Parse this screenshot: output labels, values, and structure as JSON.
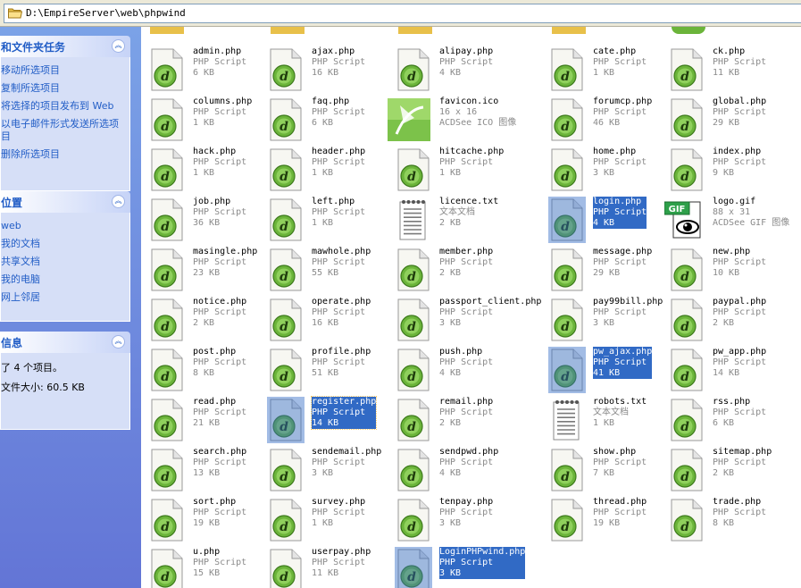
{
  "address_bar": {
    "path": "D:\\EmpireServer\\web\\phpwind"
  },
  "task_pane": {
    "file_tasks": {
      "title": "和文件夹任务",
      "items": [
        "移动所选项目",
        "复制所选项目",
        "将选择的项目发布到 Web",
        "以电子邮件形式发送所选项目",
        "删除所选项目"
      ]
    },
    "other_places": {
      "title": "位置",
      "items": [
        "web",
        "我的文档",
        "共享文档",
        "我的电脑",
        "网上邻居"
      ]
    },
    "details": {
      "title": "信息",
      "selected": "了 4 个项目。",
      "total_size": "文件大小: 60.5 KB"
    }
  },
  "files": [
    {
      "name": "admin.php",
      "type": "PHP Script",
      "size": "6 KB",
      "icon": "php",
      "selected": false
    },
    {
      "name": "ajax.php",
      "type": "PHP Script",
      "size": "16 KB",
      "icon": "php",
      "selected": false
    },
    {
      "name": "alipay.php",
      "type": "PHP Script",
      "size": "4 KB",
      "icon": "php",
      "selected": false
    },
    {
      "name": "cate.php",
      "type": "PHP Script",
      "size": "1 KB",
      "icon": "php",
      "selected": false
    },
    {
      "name": "ck.php",
      "type": "PHP Script",
      "size": "11 KB",
      "icon": "php",
      "selected": false
    },
    {
      "name": "columns.php",
      "type": "PHP Script",
      "size": "1 KB",
      "icon": "php",
      "selected": false
    },
    {
      "name": "faq.php",
      "type": "PHP Script",
      "size": "6 KB",
      "icon": "php",
      "selected": false
    },
    {
      "name": "favicon.ico",
      "type": "16 x 16",
      "size": "ACDSee ICO 图像",
      "icon": "ico",
      "selected": false
    },
    {
      "name": "forumcp.php",
      "type": "PHP Script",
      "size": "46 KB",
      "icon": "php",
      "selected": false
    },
    {
      "name": "global.php",
      "type": "PHP Script",
      "size": "29 KB",
      "icon": "php",
      "selected": false
    },
    {
      "name": "hack.php",
      "type": "PHP Script",
      "size": "1 KB",
      "icon": "php",
      "selected": false
    },
    {
      "name": "header.php",
      "type": "PHP Script",
      "size": "1 KB",
      "icon": "php",
      "selected": false
    },
    {
      "name": "hitcache.php",
      "type": "PHP Script",
      "size": "1 KB",
      "icon": "php",
      "selected": false
    },
    {
      "name": "home.php",
      "type": "PHP Script",
      "size": "3 KB",
      "icon": "php",
      "selected": false
    },
    {
      "name": "index.php",
      "type": "PHP Script",
      "size": "9 KB",
      "icon": "php",
      "selected": false
    },
    {
      "name": "job.php",
      "type": "PHP Script",
      "size": "36 KB",
      "icon": "php",
      "selected": false
    },
    {
      "name": "left.php",
      "type": "PHP Script",
      "size": "1 KB",
      "icon": "php",
      "selected": false
    },
    {
      "name": "licence.txt",
      "type": "文本文档",
      "size": "2 KB",
      "icon": "txt",
      "selected": false
    },
    {
      "name": "login.php",
      "type": "PHP Script",
      "size": "4 KB",
      "icon": "php",
      "selected": true
    },
    {
      "name": "logo.gif",
      "type": "88 x 31",
      "size": "ACDSee GIF 图像",
      "icon": "gif",
      "selected": false
    },
    {
      "name": "masingle.php",
      "type": "PHP Script",
      "size": "23 KB",
      "icon": "php",
      "selected": false
    },
    {
      "name": "mawhole.php",
      "type": "PHP Script",
      "size": "55 KB",
      "icon": "php",
      "selected": false
    },
    {
      "name": "member.php",
      "type": "PHP Script",
      "size": "2 KB",
      "icon": "php",
      "selected": false
    },
    {
      "name": "message.php",
      "type": "PHP Script",
      "size": "29 KB",
      "icon": "php",
      "selected": false
    },
    {
      "name": "new.php",
      "type": "PHP Script",
      "size": "10 KB",
      "icon": "php",
      "selected": false
    },
    {
      "name": "notice.php",
      "type": "PHP Script",
      "size": "2 KB",
      "icon": "php",
      "selected": false
    },
    {
      "name": "operate.php",
      "type": "PHP Script",
      "size": "16 KB",
      "icon": "php",
      "selected": false
    },
    {
      "name": "passport_client.php",
      "type": "PHP Script",
      "size": "3 KB",
      "icon": "php",
      "selected": false
    },
    {
      "name": "pay99bill.php",
      "type": "PHP Script",
      "size": "3 KB",
      "icon": "php",
      "selected": false
    },
    {
      "name": "paypal.php",
      "type": "PHP Script",
      "size": "2 KB",
      "icon": "php",
      "selected": false
    },
    {
      "name": "post.php",
      "type": "PHP Script",
      "size": "8 KB",
      "icon": "php",
      "selected": false
    },
    {
      "name": "profile.php",
      "type": "PHP Script",
      "size": "51 KB",
      "icon": "php",
      "selected": false
    },
    {
      "name": "push.php",
      "type": "PHP Script",
      "size": "4 KB",
      "icon": "php",
      "selected": false
    },
    {
      "name": "pw_ajax.php",
      "type": "PHP Script",
      "size": "41 KB",
      "icon": "php",
      "selected": true
    },
    {
      "name": "pw_app.php",
      "type": "PHP Script",
      "size": "14 KB",
      "icon": "php",
      "selected": false
    },
    {
      "name": "read.php",
      "type": "PHP Script",
      "size": "21 KB",
      "icon": "php",
      "selected": false
    },
    {
      "name": "register.php",
      "type": "PHP Script",
      "size": "14 KB",
      "icon": "php",
      "selected": true,
      "focused": true
    },
    {
      "name": "remail.php",
      "type": "PHP Script",
      "size": "2 KB",
      "icon": "php",
      "selected": false
    },
    {
      "name": "robots.txt",
      "type": "文本文档",
      "size": "1 KB",
      "icon": "txt",
      "selected": false
    },
    {
      "name": "rss.php",
      "type": "PHP Script",
      "size": "6 KB",
      "icon": "php",
      "selected": false
    },
    {
      "name": "search.php",
      "type": "PHP Script",
      "size": "13 KB",
      "icon": "php",
      "selected": false
    },
    {
      "name": "sendemail.php",
      "type": "PHP Script",
      "size": "3 KB",
      "icon": "php",
      "selected": false
    },
    {
      "name": "sendpwd.php",
      "type": "PHP Script",
      "size": "4 KB",
      "icon": "php",
      "selected": false
    },
    {
      "name": "show.php",
      "type": "PHP Script",
      "size": "7 KB",
      "icon": "php",
      "selected": false
    },
    {
      "name": "sitemap.php",
      "type": "PHP Script",
      "size": "2 KB",
      "icon": "php",
      "selected": false
    },
    {
      "name": "sort.php",
      "type": "PHP Script",
      "size": "19 KB",
      "icon": "php",
      "selected": false
    },
    {
      "name": "survey.php",
      "type": "PHP Script",
      "size": "1 KB",
      "icon": "php",
      "selected": false
    },
    {
      "name": "tenpay.php",
      "type": "PHP Script",
      "size": "3 KB",
      "icon": "php",
      "selected": false
    },
    {
      "name": "thread.php",
      "type": "PHP Script",
      "size": "19 KB",
      "icon": "php",
      "selected": false
    },
    {
      "name": "trade.php",
      "type": "PHP Script",
      "size": "8 KB",
      "icon": "php",
      "selected": false
    },
    {
      "name": "u.php",
      "type": "PHP Script",
      "size": "15 KB",
      "icon": "php",
      "selected": false
    },
    {
      "name": "userpay.php",
      "type": "PHP Script",
      "size": "11 KB",
      "icon": "php",
      "selected": false
    },
    {
      "name": "LoginPHPwind.php",
      "type": "PHP Script",
      "size": "3 KB",
      "icon": "php",
      "selected": true
    }
  ],
  "colors": {
    "selection": "#316ac5",
    "taskpane": "#6b84d9",
    "panel_body": "#d6dff7",
    "link": "#215dc6"
  }
}
